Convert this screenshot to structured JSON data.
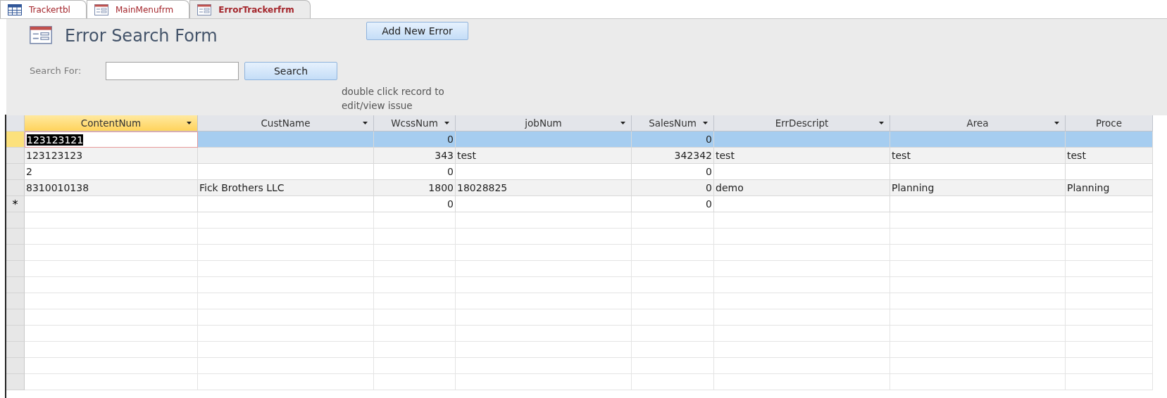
{
  "tabs": [
    {
      "label": "Trackertbl",
      "kind": "table",
      "selected": false
    },
    {
      "label": "MainMenufrm",
      "kind": "form",
      "selected": false
    },
    {
      "label": "ErrorTrackerfrm",
      "kind": "form",
      "selected": true
    }
  ],
  "form": {
    "title": "Error Search Form",
    "add_button": "Add New Error",
    "search_label": "Search For:",
    "search_button": "Search",
    "hint": "double click record to edit/view issue"
  },
  "table": {
    "columns": [
      {
        "label": "ContentNum",
        "kind": "text",
        "selected": true,
        "dropdown": true
      },
      {
        "label": "CustName",
        "kind": "text",
        "selected": false,
        "dropdown": true
      },
      {
        "label": "WcssNum",
        "kind": "number",
        "selected": false,
        "dropdown": true
      },
      {
        "label": "jobNum",
        "kind": "text",
        "selected": false,
        "dropdown": true
      },
      {
        "label": "SalesNum",
        "kind": "number",
        "selected": false,
        "dropdown": true
      },
      {
        "label": "ErrDescript",
        "kind": "text",
        "selected": false,
        "dropdown": true
      },
      {
        "label": "Area",
        "kind": "text",
        "selected": false,
        "dropdown": true
      },
      {
        "label": "Proce",
        "kind": "text",
        "selected": false,
        "dropdown": false
      }
    ],
    "rows": [
      {
        "selected": true,
        "editing": true,
        "cells": [
          "123123121",
          "",
          "0",
          "",
          "0",
          "",
          "",
          ""
        ]
      },
      {
        "selected": false,
        "editing": false,
        "cells": [
          "123123123",
          "",
          "343",
          "test",
          "342342",
          "test",
          "test",
          "test"
        ]
      },
      {
        "selected": false,
        "editing": false,
        "cells": [
          "2",
          "",
          "0",
          "",
          "0",
          "",
          "",
          ""
        ]
      },
      {
        "selected": false,
        "editing": false,
        "cells": [
          "8310010138",
          "Fick Brothers LLC",
          "1800",
          "18028825",
          "0",
          "demo",
          "Planning",
          "Planning"
        ]
      },
      {
        "selected": false,
        "editing": false,
        "selector": "*",
        "cells": [
          "",
          "",
          "0",
          "",
          "0",
          "",
          "",
          ""
        ]
      }
    ]
  }
}
